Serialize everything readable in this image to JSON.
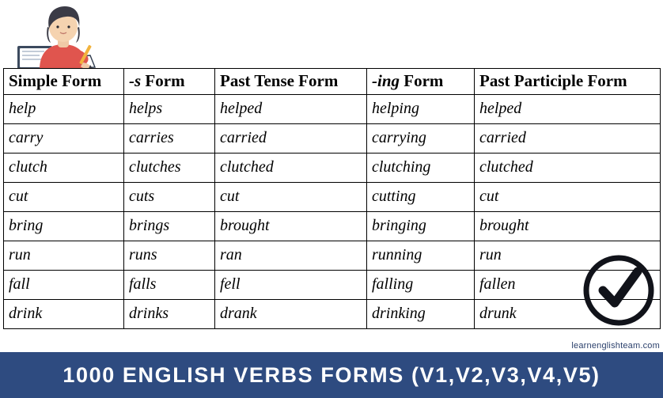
{
  "illustration": {
    "alt": "girl-studying-at-desk-illustration"
  },
  "table": {
    "headers": [
      {
        "main": "Simple Form",
        "italic_prefix": ""
      },
      {
        "main": " Form",
        "italic_prefix": "-s"
      },
      {
        "main": "Past Tense Form",
        "italic_prefix": ""
      },
      {
        "main": " Form",
        "italic_prefix": "-ing"
      },
      {
        "main": "Past Participle Form",
        "italic_prefix": ""
      }
    ],
    "rows": [
      [
        "help",
        "helps",
        "helped",
        "helping",
        "helped"
      ],
      [
        "carry",
        "carries",
        "carried",
        "carrying",
        "carried"
      ],
      [
        "clutch",
        "clutches",
        "clutched",
        "clutching",
        "clutched"
      ],
      [
        "cut",
        "cuts",
        "cut",
        "cutting",
        "cut"
      ],
      [
        "bring",
        "brings",
        "brought",
        "bringing",
        "brought"
      ],
      [
        "run",
        "runs",
        "ran",
        "running",
        "run"
      ],
      [
        "fall",
        "falls",
        "fell",
        "falling",
        "fallen"
      ],
      [
        "drink",
        "drinks",
        "drank",
        "drinking",
        "drunk"
      ]
    ]
  },
  "check_badge": {
    "name": "check-mark-icon"
  },
  "site_credit": "learnenglishteam.com",
  "banner": {
    "title": "1000 English Verbs Forms (V1,V2,V3,V4,V5)",
    "background_color": "#2e4b80",
    "text_color": "#ffffff"
  }
}
